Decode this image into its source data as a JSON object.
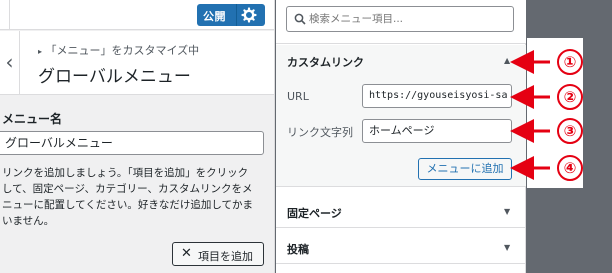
{
  "header": {
    "publish_label": "公開",
    "breadcrumb": "「メニュー」をカスタマイズ中",
    "section_title": "グローバルメニュー"
  },
  "menu": {
    "name_label": "メニュー名",
    "name_value": "グローバルメニュー",
    "description_lines": [
      "リンクを追加しましょう。「項目を追加」をクリック",
      "して、固定ページ、カテゴリー、カスタムリンクをメ",
      "ニューに配置してください。好きなだけ追加してかま",
      "いません。"
    ],
    "add_items_label": "項目を追加"
  },
  "available": {
    "search_placeholder": "検索メニュー項目...",
    "custom_link": {
      "title": "カスタムリンク",
      "url_label": "URL",
      "url_value": "https://gyouseisyosi-sa",
      "link_text_label": "リンク文字列",
      "link_text_value": "ホームページ",
      "add_button": "メニューに追加"
    },
    "sections": [
      "固定ページ",
      "投稿"
    ]
  },
  "callouts": [
    "①",
    "②",
    "③",
    "④"
  ],
  "colors": {
    "primary": "#2271b1",
    "callout": "#e50012",
    "backdrop": "#646970"
  }
}
